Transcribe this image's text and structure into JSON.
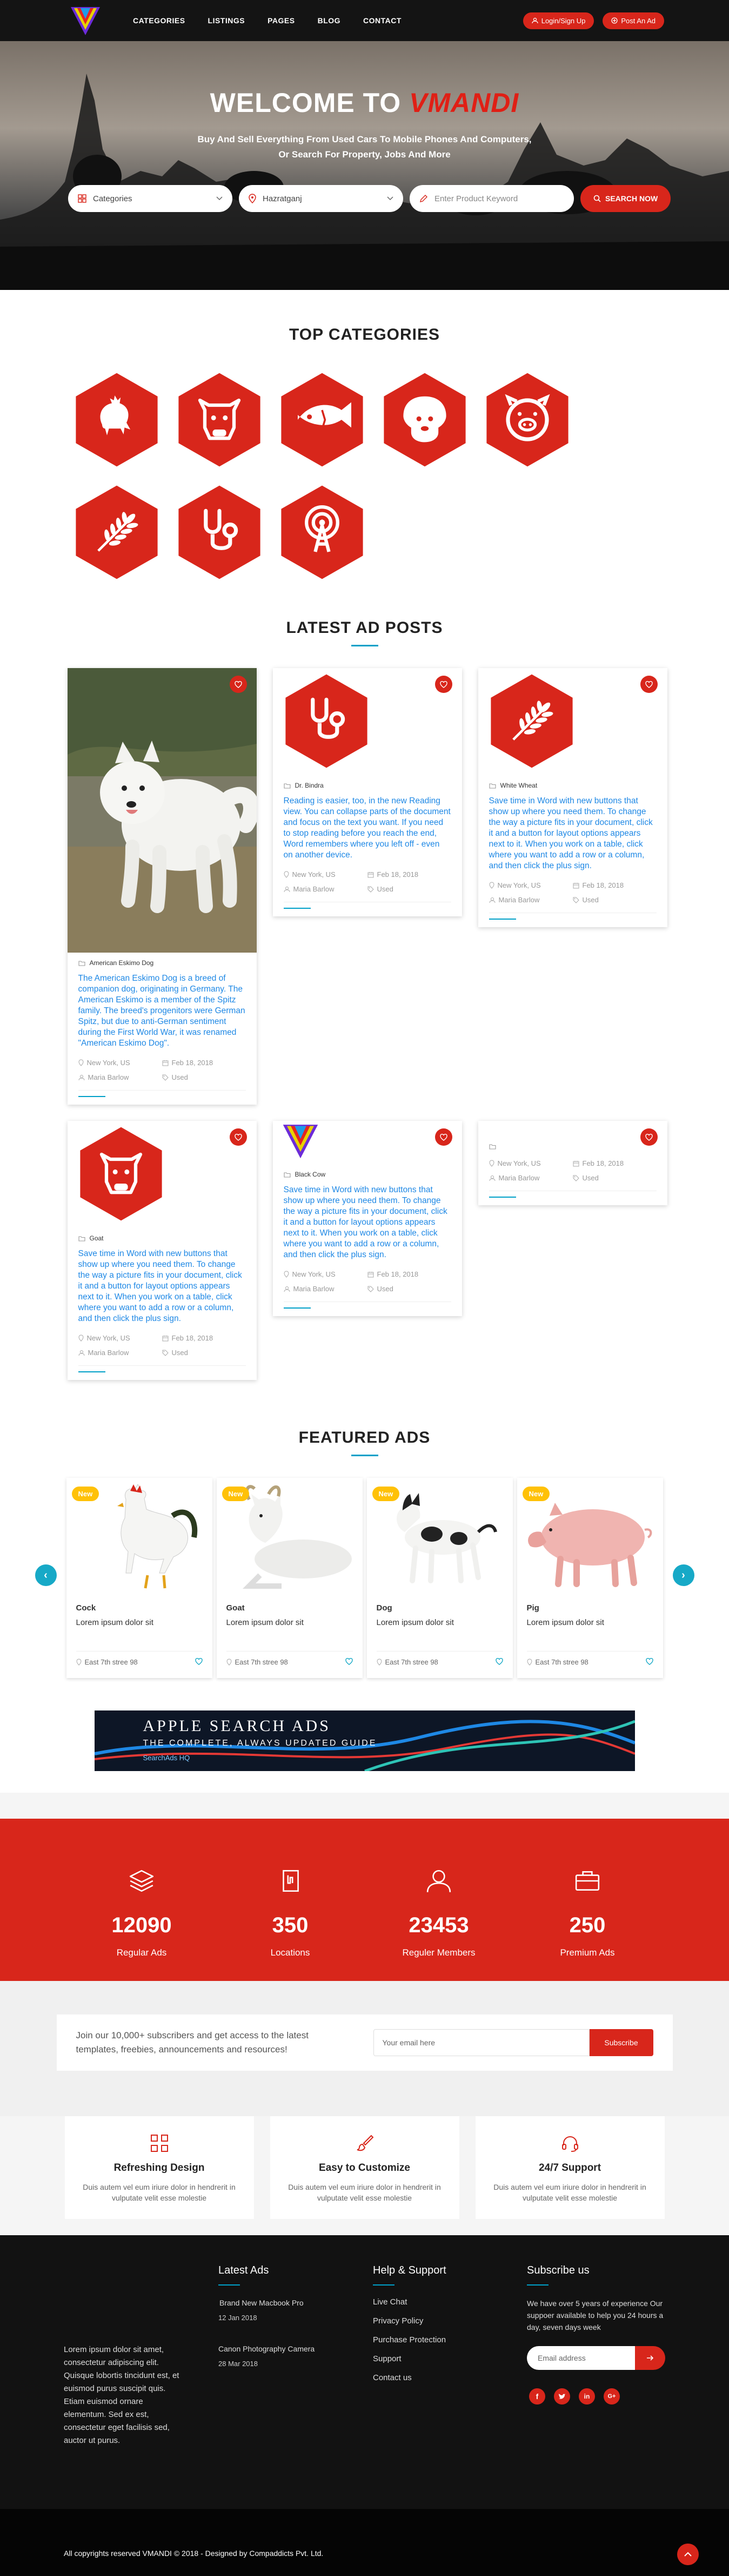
{
  "header": {
    "logo_name": "vmandi-logo",
    "nav": [
      "CATEGORIES",
      "LISTINGS",
      "PAGES",
      "BLOG",
      "CONTACT"
    ],
    "login_label": "Login/Sign Up",
    "post_ad_label": "Post An Ad"
  },
  "hero": {
    "title_prefix": "WELCOME TO",
    "title_brand": "VMANDI",
    "subtitle_line1": "Buy And Sell Everything From Used Cars To Mobile Phones And Computers,",
    "subtitle_line2": "Or Search For Property, Jobs And More",
    "category_select": "Categories",
    "location_value": "Hazratganj",
    "keyword_placeholder": "Enter Product Keyword",
    "search_button": "SEARCH NOW"
  },
  "top_categories": {
    "title": "TOP CATEGORIES",
    "icons": [
      "chicken-icon",
      "cow-icon",
      "fish-icon",
      "dog-icon",
      "pig-icon",
      "wheat-icon",
      "stethoscope-icon",
      "tower-icon"
    ]
  },
  "latest": {
    "title": "LATEST AD POSTS",
    "posts": [
      {
        "title": "American Eskimo Dog",
        "desc": "The American Eskimo Dog is a breed of companion dog, originating in Germany. The American Eskimo is a member of the Spitz family. The breed's progenitors were German Spitz, but due to anti-German sentiment during the First World War, it was renamed \"American Eskimo Dog\".",
        "location": "New York, US",
        "date": "Feb 18, 2018",
        "seller": "Maria Barlow",
        "condition": "Used"
      },
      {
        "title": "Dr. Bindra",
        "desc": "Reading is easier, too, in the new Reading view. You can collapse parts of the document and focus on the text you want. If you need to stop reading before you reach the end, Word remembers where you left off - even on another device.",
        "location": "New York, US",
        "date": "Feb 18, 2018",
        "seller": "Maria Barlow",
        "condition": "Used"
      },
      {
        "title": "White Wheat",
        "desc": "Save time in Word with new buttons that show up where you need them. To change the way a picture fits in your document, click it and a button for layout options appears next to it. When you work on a table, click where you want to add a row or a column, and then click the plus sign.",
        "location": "New York, US",
        "date": "Feb 18, 2018",
        "seller": "Maria Barlow",
        "condition": "Used"
      },
      {
        "title": "Goat",
        "desc": "Save time in Word with new buttons that show up where you need them. To change the way a picture fits in your document, click it and a button for layout options appears next to it. When you work on a table, click where you want to add a row or a column, and then click the plus sign.",
        "location": "New York, US",
        "date": "Feb 18, 2018",
        "seller": "Maria Barlow",
        "condition": "Used"
      },
      {
        "title": "Black Cow",
        "desc": "Save time in Word with new buttons that show up where you need them. To change the way a picture fits in your document, click it and a button for layout options appears next to it. When you work on a table, click where you want to add a row or a column, and then click the plus sign.",
        "location": "New York, US",
        "date": "Feb 18, 2018",
        "seller": "Maria Barlow",
        "condition": "Used"
      },
      {
        "title": "",
        "desc": "",
        "location": "New York, US",
        "date": "Feb 18, 2018",
        "seller": "Maria Barlow",
        "condition": "Used"
      }
    ]
  },
  "featured": {
    "title": "FEATURED ADS",
    "badge": "New",
    "items": [
      {
        "name": "Cock",
        "desc": "Lorem ipsum dolor sit",
        "location": "East 7th stree 98"
      },
      {
        "name": "Goat",
        "desc": "Lorem ipsum dolor sit",
        "location": "East 7th stree 98"
      },
      {
        "name": "Dog",
        "desc": "Lorem ipsum dolor sit",
        "location": "East 7th stree 98"
      },
      {
        "name": "Pig",
        "desc": "Lorem ipsum dolor sit",
        "location": "East 7th stree 98"
      }
    ]
  },
  "banner": {
    "headline": "APPLE SEARCH ADS",
    "subline": "THE COMPLETE, ALWAYS UPDATED GUIDE",
    "brand": "SearchAds HQ"
  },
  "stats": [
    {
      "num": "12090",
      "label": "Regular Ads",
      "icon": "layers-icon"
    },
    {
      "num": "350",
      "label": "Locations",
      "icon": "map-icon"
    },
    {
      "num": "23453",
      "label": "Reguler Members",
      "icon": "user-icon"
    },
    {
      "num": "250",
      "label": "Premium Ads",
      "icon": "briefcase-icon"
    }
  ],
  "subscribe": {
    "text_line1": "Join our 10,000+ subscribers and get access to the latest",
    "text_line2": "templates, freebies, announcements and resources!",
    "placeholder": "Your email here",
    "button": "Subscribe"
  },
  "features": [
    {
      "title": "Refreshing Design",
      "text": "Duis autem vel eum iriure dolor in hendrerit in vulputate velit esse molestie"
    },
    {
      "title": "Easy to Customize",
      "text": "Duis autem vel eum iriure dolor in hendrerit in vulputate velit esse molestie"
    },
    {
      "title": "24/7 Support",
      "text": "Duis autem vel eum iriure dolor in hendrerit in vulputate velit esse molestie"
    }
  ],
  "footer": {
    "about": "Lorem ipsum dolor sit amet, consectetur adipiscing elit. Quisque lobortis tincidunt est, et euismod purus suscipit quis. Etiam euismod ornare elementum. Sed ex est, consectetur eget facilisis sed, auctor ut purus.",
    "latest_title": "Latest Ads",
    "latest_items": [
      {
        "title": "Brand New Macbook Pro",
        "date": "12 Jan 2018"
      },
      {
        "title": "Canon Photography Camera",
        "date": "28 Mar 2018"
      }
    ],
    "help_title": "Help & Support",
    "help_links": [
      "Live Chat",
      "Privacy Policy",
      "Purchase Protection",
      "Support",
      "Contact us"
    ],
    "subscribe_title": "Subscribe us",
    "subscribe_text": "We have over 5 years of experience Our suppoer available to help you 24 hours a day, seven days week",
    "email_placeholder": "Email address",
    "copyright": "All copyrights reserved VMANDI © 2018 - Designed by Compaddicts Pvt. Ltd."
  }
}
